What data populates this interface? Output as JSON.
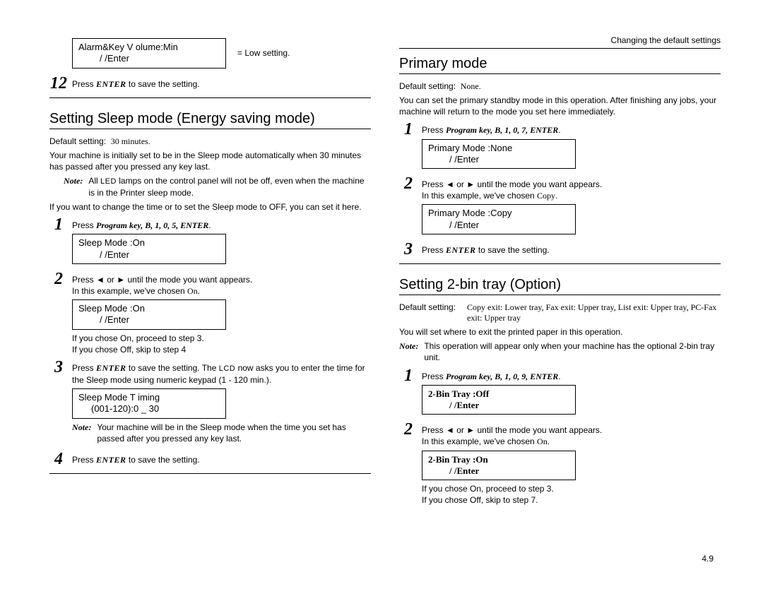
{
  "header": {
    "breadcrumb": "Changing the default settings"
  },
  "left": {
    "lcd_alarm_l1": "Alarm&Key V olume:Min",
    "lcd_alarm_l2": "/ /Enter",
    "eq_low": "= Low setting.",
    "step12_num": "12",
    "step12_text_a": "Press ",
    "step12_enter": "ENTER",
    "step12_text_b": " to save the setting.",
    "section_title": "Setting Sleep mode (Energy saving mode)",
    "default_label": "Default setting:",
    "default_value": "30 minutes.",
    "para1": "Your machine is initially set to be in the Sleep mode automatically when 30 minutes has passed after you pressed any key last.",
    "note1_a": "All ",
    "note1_led": "LED",
    "note1_b": " lamps on the control panel will not be off, even when the machine is in the Printer sleep mode.",
    "para2": "If you want to change the time or to set the Sleep mode to OFF, you can set it here.",
    "s1_num": "1",
    "s1_text": "Press ",
    "s1_keys": "Program key, B, 1, 0, 5, ENTER",
    "s1_dot": ".",
    "lcd_sleep1_l1": "Sleep Mode :On",
    "lcd_sleep1_l2": "/ /Enter",
    "s2_num": "2",
    "s2_text_a": "Press ",
    "s2_tri1": "◄",
    "s2_or": " or ",
    "s2_tri2": "►",
    "s2_text_b": " until the mode you want appears.",
    "s2_text_c": "In this example, we've chosen ",
    "s2_on": "On",
    "s2_dot": ".",
    "lcd_sleep2_l1": "Sleep Mode :On",
    "lcd_sleep2_l2": "/ /Enter",
    "s2_if_on": "If you chose On, proceed to step 3.",
    "s2_if_off": "If you chose Off, skip to step 4",
    "s3_num": "3",
    "s3_text_a": "Press ",
    "s3_enter": "ENTER",
    "s3_text_b": " to save the setting. The ",
    "s3_lcd": "LCD",
    "s3_text_c": " now asks you to enter the time for the Sleep mode using numeric keypad (1 - 120 min.).",
    "lcd_time_l1": "Sleep Mode T iming",
    "lcd_time_l2": "(001-120):0 _ 30",
    "note2": "Your machine will be in the Sleep mode when the time you set has passed after you pressed any key last.",
    "s4_num": "4",
    "s4_text_a": "Press ",
    "s4_enter": "ENTER",
    "s4_text_b": " to save the setting."
  },
  "right": {
    "section1_title": "Primary mode",
    "default1_label": "Default setting:",
    "default1_value": "None.",
    "para1": "You can set the primary standby mode in this operation. After finishing any jobs, your machine will return to the mode you set here immediately.",
    "p1_num": "1",
    "p1_text": "Press ",
    "p1_keys": "Program key, B, 1, 0, 7, ENTER",
    "p1_dot": ".",
    "lcd_pm1_l1": "Primary Mode :None",
    "lcd_pm1_l2": "/ /Enter",
    "p2_num": "2",
    "p2_text_a": "Press ",
    "p2_tri1": "◄",
    "p2_or": " or ",
    "p2_tri2": "►",
    "p2_text_b": " until the mode you want appears.",
    "p2_text_c": "In this example, we've chosen ",
    "p2_copy": "Copy",
    "p2_dot": ".",
    "lcd_pm2_l1": "Primary Mode :Copy",
    "lcd_pm2_l2": "/ /Enter",
    "p3_num": "3",
    "p3_text_a": "Press ",
    "p3_enter": "ENTER",
    "p3_text_b": " to save the setting.",
    "section2_title": "Setting 2-bin tray (Option)",
    "default2_label": "Default setting:",
    "default2_value": "Copy exit: Lower tray, Fax exit: Upper tray, List exit: Upper tray, PC-Fax exit: Upper tray",
    "para2": "You will set where to exit the printed paper in this operation.",
    "note1": "This operation will appear only when your machine has the optional 2-bin tray unit.",
    "b1_num": "1",
    "b1_text": "Press ",
    "b1_keys": "Program key, B, 1, 0, 9, ENTER",
    "b1_dot": ".",
    "lcd_bt1_l1": "2-Bin Tray   :Off",
    "lcd_bt1_l2": "/   /Enter",
    "b2_num": "2",
    "b2_text_a": "Press ",
    "b2_tri1": "◄",
    "b2_or": " or ",
    "b2_tri2": "►",
    "b2_text_b": " until the mode you want appears.",
    "b2_text_c": "In this example, we've chosen ",
    "b2_on": "On",
    "b2_dot": ".",
    "lcd_bt2_l1": "2-Bin Tray   :On",
    "lcd_bt2_l2": "/   /Enter",
    "b2_if_on": "If you chose On, proceed to step 3.",
    "b2_if_off": "If you chose Off, skip to step 7."
  },
  "note_label": "Note:",
  "footer": "4.9"
}
